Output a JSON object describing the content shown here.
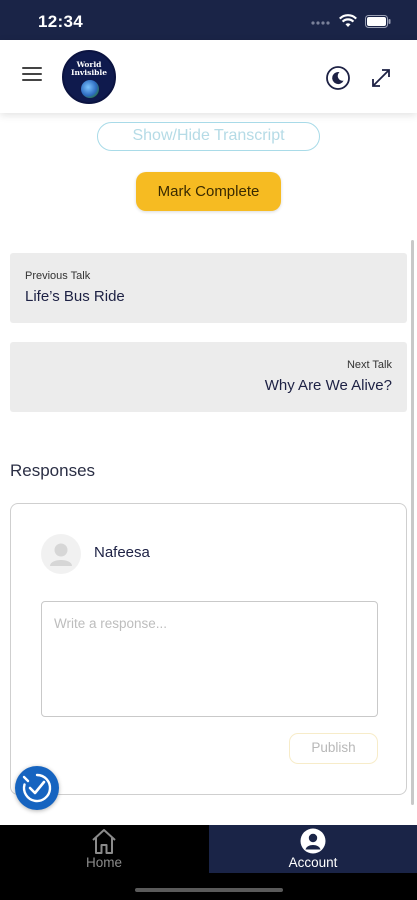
{
  "status_bar": {
    "time": "12:34"
  },
  "header": {
    "logo_line1": "World",
    "logo_line2": "Invisible",
    "icons": [
      "menu-icon",
      "moon-icon",
      "expand-icon"
    ]
  },
  "actions": {
    "transcript_label": "Show/Hide Transcript",
    "complete_label": "Mark Complete"
  },
  "previous_talk": {
    "caption": "Previous Talk",
    "title": "Life’s Bus Ride"
  },
  "next_talk": {
    "caption": "Next Talk",
    "title": "Why Are We Alive?"
  },
  "responses": {
    "heading": "Responses",
    "user_name": "Nafeesa",
    "input_placeholder": "Write a response...",
    "publish_label": "Publish"
  },
  "tab_bar": {
    "tabs": [
      {
        "label": "Home",
        "icon": "home-icon",
        "active": false
      },
      {
        "label": "Account",
        "icon": "account-icon",
        "active": true
      }
    ]
  },
  "colors": {
    "navy": "#1a2447",
    "accent_yellow": "#f6bb22",
    "card_gray": "#ececec",
    "a11y_blue": "#1664c0"
  }
}
